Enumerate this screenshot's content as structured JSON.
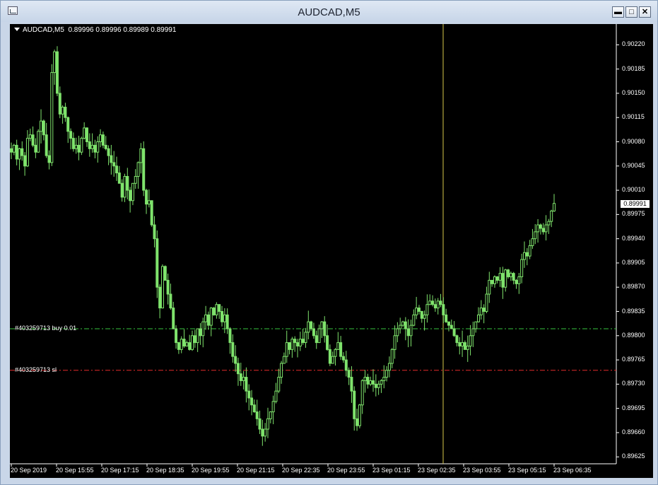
{
  "window": {
    "title": "AUDCAD,M5",
    "buttons": [
      "minimize",
      "maximize",
      "close"
    ]
  },
  "chart": {
    "symbol_label": "AUDCAD,M5",
    "ohlc_label": "0.89996 0.89996 0.89989 0.89991",
    "current_price": "0.89991",
    "orders": [
      {
        "label": "#403259713 buy 0.01",
        "price": 0.8981,
        "color": "#39c43f"
      },
      {
        "label": "#403259713 sl",
        "price": 0.8975,
        "color": "#e12a2a"
      }
    ],
    "price_ticks": [
      "0.90220",
      "0.90185",
      "0.90150",
      "0.90115",
      "0.90080",
      "0.90045",
      "0.90010",
      "0.89975",
      "0.89940",
      "0.89905",
      "0.89870",
      "0.89835",
      "0.89800",
      "0.89765",
      "0.89730",
      "0.89695",
      "0.89660",
      "0.89625"
    ],
    "time_ticks": [
      "20 Sep 2019",
      "20 Sep 15:55",
      "20 Sep 17:15",
      "20 Sep 18:35",
      "20 Sep 19:55",
      "20 Sep 21:15",
      "20 Sep 22:35",
      "20 Sep 23:55",
      "23 Sep 01:15",
      "23 Sep 02:35",
      "23 Sep 03:55",
      "23 Sep 05:15",
      "23 Sep 06:35"
    ],
    "candle_color": "#7fe36c",
    "background": "#000000",
    "vertical_line_color": "#d8c84a"
  },
  "chart_data": {
    "type": "candlestick",
    "title": "AUDCAD,M5",
    "ylim": [
      0.89615,
      0.9025
    ],
    "close_series": [
      0.90065,
      0.90075,
      0.90055,
      0.9007,
      0.9006,
      0.90045,
      0.90085,
      0.9009,
      0.90075,
      0.90065,
      0.90095,
      0.9011,
      0.9009,
      0.9006,
      0.9005,
      0.9018,
      0.9021,
      0.9015,
      0.9012,
      0.9013,
      0.90115,
      0.90095,
      0.90085,
      0.9007,
      0.90075,
      0.90065,
      0.90085,
      0.901,
      0.9008,
      0.9007,
      0.90075,
      0.90065,
      0.9008,
      0.9009,
      0.90075,
      0.9007,
      0.9006,
      0.9005,
      0.90045,
      0.90035,
      0.9002,
      0.9,
      0.9003,
      0.9001,
      0.89995,
      0.9002,
      0.9003,
      0.9005,
      0.9007,
      0.9001,
      0.8999,
      0.89995,
      0.8996,
      0.8994,
      0.8987,
      0.8984,
      0.899,
      0.8988,
      0.8986,
      0.8984,
      0.8981,
      0.8979,
      0.8978,
      0.89795,
      0.89785,
      0.8979,
      0.8978,
      0.898,
      0.8979,
      0.8981,
      0.898,
      0.8982,
      0.8983,
      0.89815,
      0.8984,
      0.8983,
      0.89845,
      0.89835,
      0.8982,
      0.8983,
      0.8981,
      0.8979,
      0.8977,
      0.8976,
      0.89745,
      0.89735,
      0.8974,
      0.8972,
      0.8971,
      0.897,
      0.8969,
      0.8968,
      0.89665,
      0.89655,
      0.89665,
      0.8968,
      0.8969,
      0.89705,
      0.8972,
      0.8974,
      0.8976,
      0.8977,
      0.8979,
      0.8978,
      0.89795,
      0.8979,
      0.89785,
      0.89795,
      0.8979,
      0.89805,
      0.8982,
      0.8981,
      0.898,
      0.8979,
      0.8981,
      0.8982,
      0.898,
      0.8978,
      0.8976,
      0.8977,
      0.8978,
      0.8979,
      0.8977,
      0.89765,
      0.8975,
      0.8974,
      0.8972,
      0.8968,
      0.8967,
      0.897,
      0.89735,
      0.8974,
      0.8973,
      0.89735,
      0.8973,
      0.89725,
      0.8973,
      0.89735,
      0.8974,
      0.8975,
      0.8976,
      0.8978,
      0.898,
      0.8981,
      0.89815,
      0.8982,
      0.8981,
      0.898,
      0.89815,
      0.8983,
      0.8984,
      0.89835,
      0.89825,
      0.8983,
      0.89845,
      0.8985,
      0.89845,
      0.8984,
      0.8985,
      0.89845,
      0.8983,
      0.8982,
      0.89815,
      0.8981,
      0.898,
      0.8979,
      0.89785,
      0.8979,
      0.8978,
      0.89785,
      0.898,
      0.8981,
      0.8982,
      0.8983,
      0.8984,
      0.89835,
      0.8986,
      0.8988,
      0.89875,
      0.89885,
      0.8988,
      0.8989,
      0.8987,
      0.89895,
      0.89885,
      0.8989,
      0.8988,
      0.89875,
      0.89885,
      0.8991,
      0.8992,
      0.89915,
      0.8993,
      0.8994,
      0.8995,
      0.8996,
      0.89955,
      0.8995,
      0.8996,
      0.89965,
      0.8998,
      0.89991
    ]
  }
}
